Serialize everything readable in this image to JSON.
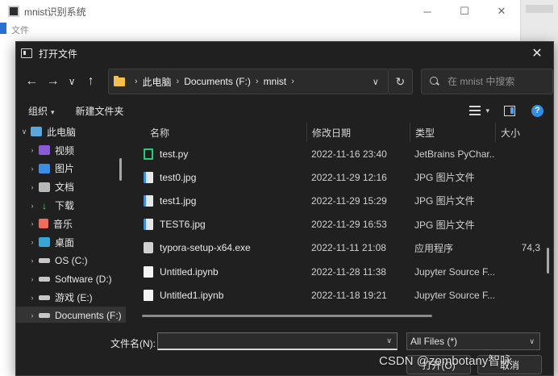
{
  "parent_window": {
    "title": "mnist识别系统",
    "menu": [
      "文件"
    ],
    "controls": {
      "minimize": "─",
      "maximize": "☐",
      "close": "✕"
    }
  },
  "dialog": {
    "title": "打开文件",
    "close_glyph": "✕",
    "nav": {
      "back": "←",
      "forward": "→",
      "recent": "∨",
      "up": "↑",
      "refresh": "↻",
      "address_dropdown": "∨"
    },
    "breadcrumb": [
      "此电脑",
      "Documents (F:)",
      "mnist"
    ],
    "search": {
      "placeholder": "在 mnist 中搜索"
    },
    "commands": {
      "organize": "组织",
      "new_folder": "新建文件夹"
    },
    "sidebar": {
      "items": [
        {
          "label": "此电脑",
          "icon": "computer-icon",
          "expand": "∨",
          "level": 0
        },
        {
          "label": "视频",
          "icon": "video-folder-icon",
          "expand": "›",
          "level": 1
        },
        {
          "label": "图片",
          "icon": "pictures-folder-icon",
          "expand": "›",
          "level": 1
        },
        {
          "label": "文档",
          "icon": "documents-folder-icon",
          "expand": "›",
          "level": 1
        },
        {
          "label": "下载",
          "icon": "download-icon",
          "expand": "›",
          "level": 1
        },
        {
          "label": "音乐",
          "icon": "music-icon",
          "expand": "›",
          "level": 1
        },
        {
          "label": "桌面",
          "icon": "desktop-icon",
          "expand": "›",
          "level": 1
        },
        {
          "label": "OS (C:)",
          "icon": "drive-icon",
          "expand": "›",
          "level": 1
        },
        {
          "label": "Software (D:)",
          "icon": "drive-icon",
          "expand": "›",
          "level": 1
        },
        {
          "label": "游戏 (E:)",
          "icon": "drive-icon",
          "expand": "›",
          "level": 1
        },
        {
          "label": "Documents (F:)",
          "icon": "drive-icon",
          "expand": "›",
          "level": 1,
          "selected": true
        }
      ]
    },
    "columns": {
      "name": "名称",
      "date": "修改日期",
      "type": "类型",
      "size": "大小",
      "sort_indicator": "^"
    },
    "files": [
      {
        "name": "test.py",
        "date": "2022-11-16 23:40",
        "type": "JetBrains PyChar...",
        "size": "",
        "icon": "python-file-icon"
      },
      {
        "name": "test0.jpg",
        "date": "2022-11-29 12:16",
        "type": "JPG 图片文件",
        "size": "",
        "icon": "image-file-icon"
      },
      {
        "name": "test1.jpg",
        "date": "2022-11-29 15:29",
        "type": "JPG 图片文件",
        "size": "",
        "icon": "image-file-icon"
      },
      {
        "name": "TEST6.jpg",
        "date": "2022-11-29 16:53",
        "type": "JPG 图片文件",
        "size": "",
        "icon": "image-file-icon"
      },
      {
        "name": "typora-setup-x64.exe",
        "date": "2022-11-11 21:08",
        "type": "应用程序",
        "size": "74,3",
        "icon": "exe-file-icon"
      },
      {
        "name": "Untitled.ipynb",
        "date": "2022-11-28 11:38",
        "type": "Jupyter Source F...",
        "size": "",
        "icon": "notebook-file-icon"
      },
      {
        "name": "Untitled1.ipynb",
        "date": "2022-11-18 19:21",
        "type": "Jupyter Source F...",
        "size": "",
        "icon": "notebook-file-icon"
      }
    ],
    "footer": {
      "filename_label": "文件名(N):",
      "filename_value": "",
      "filetype": "All Files (*)",
      "open_label": "打开(O)",
      "cancel_label": "取消"
    }
  },
  "watermark": "CSDN @zombotany智咏"
}
